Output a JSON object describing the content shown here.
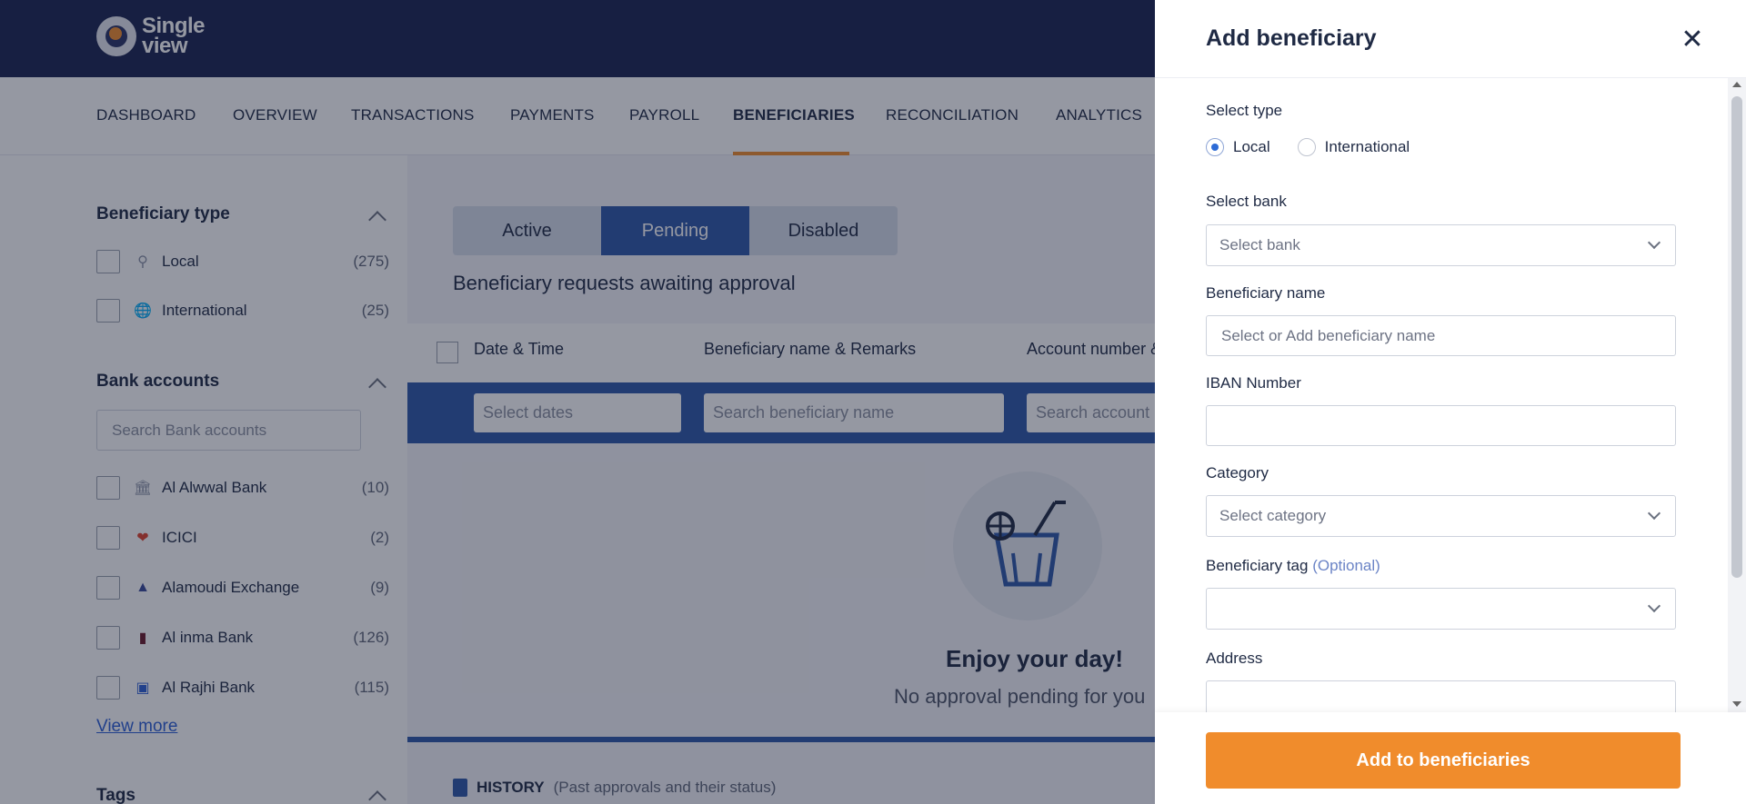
{
  "app": {
    "logo_line1": "Single",
    "logo_line2": "view"
  },
  "nav": {
    "items": [
      {
        "label": "DASHBOARD"
      },
      {
        "label": "OVERVIEW"
      },
      {
        "label": "TRANSACTIONS"
      },
      {
        "label": "PAYMENTS"
      },
      {
        "label": "PAYROLL"
      },
      {
        "label": "BENEFICIARIES"
      },
      {
        "label": "RECONCILIATION"
      },
      {
        "label": "ANALYTICS"
      }
    ],
    "active": "BENEFICIARIES"
  },
  "sidebar": {
    "beneficiary_type": {
      "title": "Beneficiary type",
      "items": [
        {
          "label": "Local",
          "count": "(275)",
          "icon": "location-pin-icon"
        },
        {
          "label": "International",
          "count": "(25)",
          "icon": "globe-icon"
        }
      ]
    },
    "bank_accounts": {
      "title": "Bank accounts",
      "search_placeholder": "Search Bank accounts",
      "items": [
        {
          "label": "Al Alwwal Bank",
          "count": "(10)",
          "icon": "bank-icon"
        },
        {
          "label": "ICICI",
          "count": "(2)",
          "icon": "icici-logo-icon"
        },
        {
          "label": "Alamoudi Exchange",
          "count": "(9)",
          "icon": "alamoudi-logo-icon"
        },
        {
          "label": "Al inma Bank",
          "count": "(126)",
          "icon": "alinma-logo-icon"
        },
        {
          "label": "Al Rajhi Bank",
          "count": "(115)",
          "icon": "alrajhi-logo-icon"
        }
      ],
      "view_more": "View more"
    },
    "tags": {
      "title": "Tags"
    }
  },
  "main": {
    "tabs": [
      {
        "label": "Active"
      },
      {
        "label": "Pending"
      },
      {
        "label": "Disabled"
      }
    ],
    "active_tab": "Pending",
    "subtitle": "Beneficiary requests awaiting approval",
    "table": {
      "columns": [
        "Date & Time",
        "Beneficiary name & Remarks",
        "Account number &"
      ],
      "filters": [
        "Select dates",
        "Search beneficiary name",
        "Search account n"
      ]
    },
    "empty": {
      "title": "Enjoy your day!",
      "subtitle": "No approval pending for you",
      "icon": "drink-glass-icon"
    },
    "history": {
      "label": "HISTORY",
      "hint": "(Past approvals and their status)"
    }
  },
  "drawer": {
    "title": "Add beneficiary",
    "select_type": {
      "label": "Select type",
      "options": [
        "Local",
        "International"
      ],
      "selected": "Local"
    },
    "select_bank": {
      "label": "Select bank",
      "placeholder": "Select bank"
    },
    "beneficiary_name": {
      "label": "Beneficiary name",
      "placeholder": "Select or Add beneficiary name"
    },
    "iban": {
      "label": "IBAN Number",
      "value": ""
    },
    "category": {
      "label": "Category",
      "placeholder": "Select category"
    },
    "tag": {
      "label": "Beneficiary tag",
      "optional": "(Optional)",
      "value": ""
    },
    "address": {
      "label": "Address",
      "value": ""
    },
    "submit": "Add to beneficiaries"
  },
  "colors": {
    "brand_navy": "#1b2451",
    "accent_orange": "#f08c2c",
    "primary_blue": "#2f58a8",
    "link_blue": "#2d5fd6"
  }
}
